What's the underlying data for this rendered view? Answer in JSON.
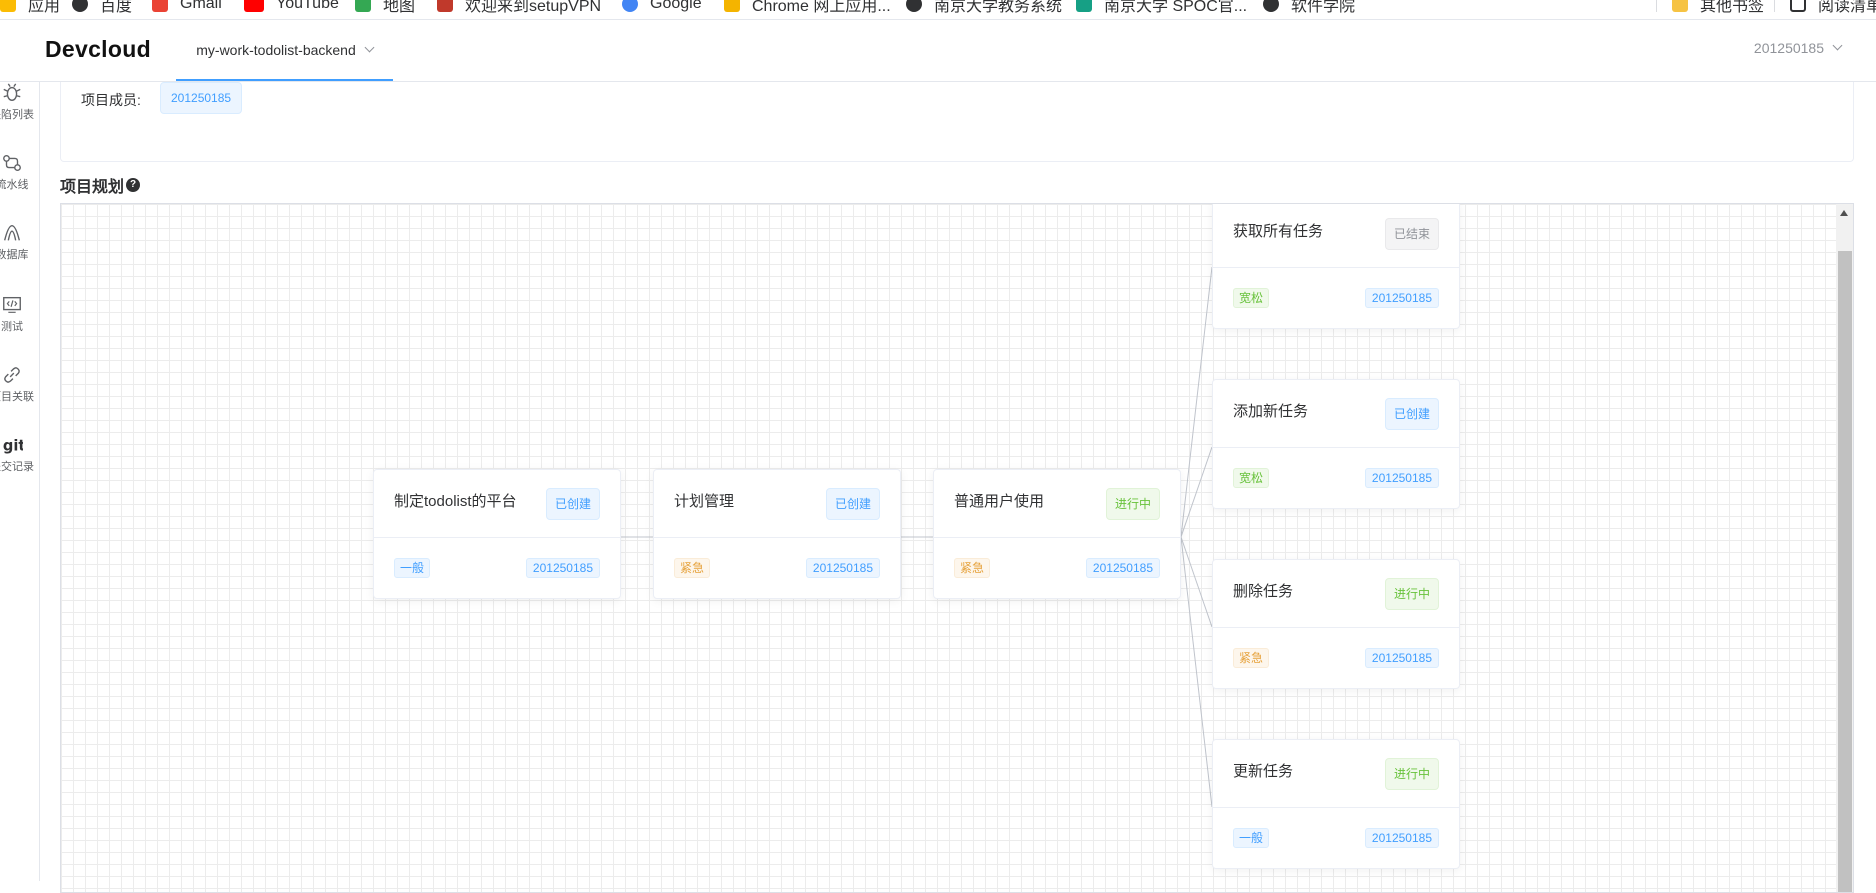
{
  "bookmarks": [
    {
      "label": "应用",
      "icon": "apps-grid-icon",
      "color": "#fbbc04"
    },
    {
      "label": "百度",
      "icon": "globe-icon",
      "color": "#303133"
    },
    {
      "label": "Gmail",
      "icon": "gmail-icon",
      "color": "#ea4335"
    },
    {
      "label": "YouTube",
      "icon": "youtube-icon",
      "color": "#ff0000"
    },
    {
      "label": "地图",
      "icon": "maps-icon",
      "color": "#34a853"
    },
    {
      "label": "欢迎来到setupVPN",
      "icon": "site-icon",
      "color": "#c0392b"
    },
    {
      "label": "Google",
      "icon": "google-icon",
      "color": "#4285f4"
    },
    {
      "label": "Chrome 网上应用...",
      "icon": "chrome-store-icon",
      "color": "#f4b400"
    },
    {
      "label": "南京大学教务系统",
      "icon": "globe-icon",
      "color": "#303133"
    },
    {
      "label": "南京大学 SPOC官...",
      "icon": "spoc-icon",
      "color": "#16a085"
    },
    {
      "label": "软件学院",
      "icon": "globe-icon",
      "color": "#303133"
    }
  ],
  "bookmarks_right": [
    {
      "label": "其他书签",
      "icon": "folder-icon",
      "color": "#f6c343"
    },
    {
      "label": "阅读清单",
      "icon": "reading-list-icon",
      "color": "#303133"
    }
  ],
  "header": {
    "logo": "Devcloud",
    "project_name": "my-work-todolist-backend",
    "user": "201250185"
  },
  "sidebar": [
    {
      "label": "缺陷列表",
      "icon": "bug-icon"
    },
    {
      "label": "流水线",
      "icon": "pipeline-icon"
    },
    {
      "label": "数据库",
      "icon": "database-icon"
    },
    {
      "label": "测试",
      "icon": "code-icon"
    },
    {
      "label": "项目关联",
      "icon": "link-icon"
    },
    {
      "label": "提交记录",
      "icon": "git-icon"
    }
  ],
  "members": {
    "label": "项目成员:",
    "list": [
      "201250185"
    ]
  },
  "planning": {
    "title": "项目规划",
    "help_icon": "question-circle-icon",
    "nodes": [
      {
        "title": "制定todolist的平台",
        "status": "已创建",
        "status_tone": "blue",
        "priority": "一般",
        "priority_tone": "blue",
        "owner": "201250185"
      },
      {
        "title": "计划管理",
        "status": "已创建",
        "status_tone": "blue",
        "priority": "紧急",
        "priority_tone": "orange",
        "owner": "201250185"
      },
      {
        "title": "普通用户使用",
        "status": "进行中",
        "status_tone": "green",
        "priority": "紧急",
        "priority_tone": "orange",
        "owner": "201250185"
      },
      {
        "title": "获取所有任务",
        "status": "已结束",
        "status_tone": "gray",
        "priority": "宽松",
        "priority_tone": "green",
        "owner": "201250185"
      },
      {
        "title": "添加新任务",
        "status": "已创建",
        "status_tone": "blue",
        "priority": "宽松",
        "priority_tone": "green",
        "owner": "201250185"
      },
      {
        "title": "删除任务",
        "status": "进行中",
        "status_tone": "green",
        "priority": "紧急",
        "priority_tone": "orange",
        "owner": "201250185"
      },
      {
        "title": "更新任务",
        "status": "进行中",
        "status_tone": "green",
        "priority": "一般",
        "priority_tone": "blue",
        "owner": "201250185"
      }
    ]
  },
  "colors": {
    "accent": "#409eff",
    "success": "#67c23a",
    "warning": "#e6a23c",
    "info": "#909399"
  }
}
